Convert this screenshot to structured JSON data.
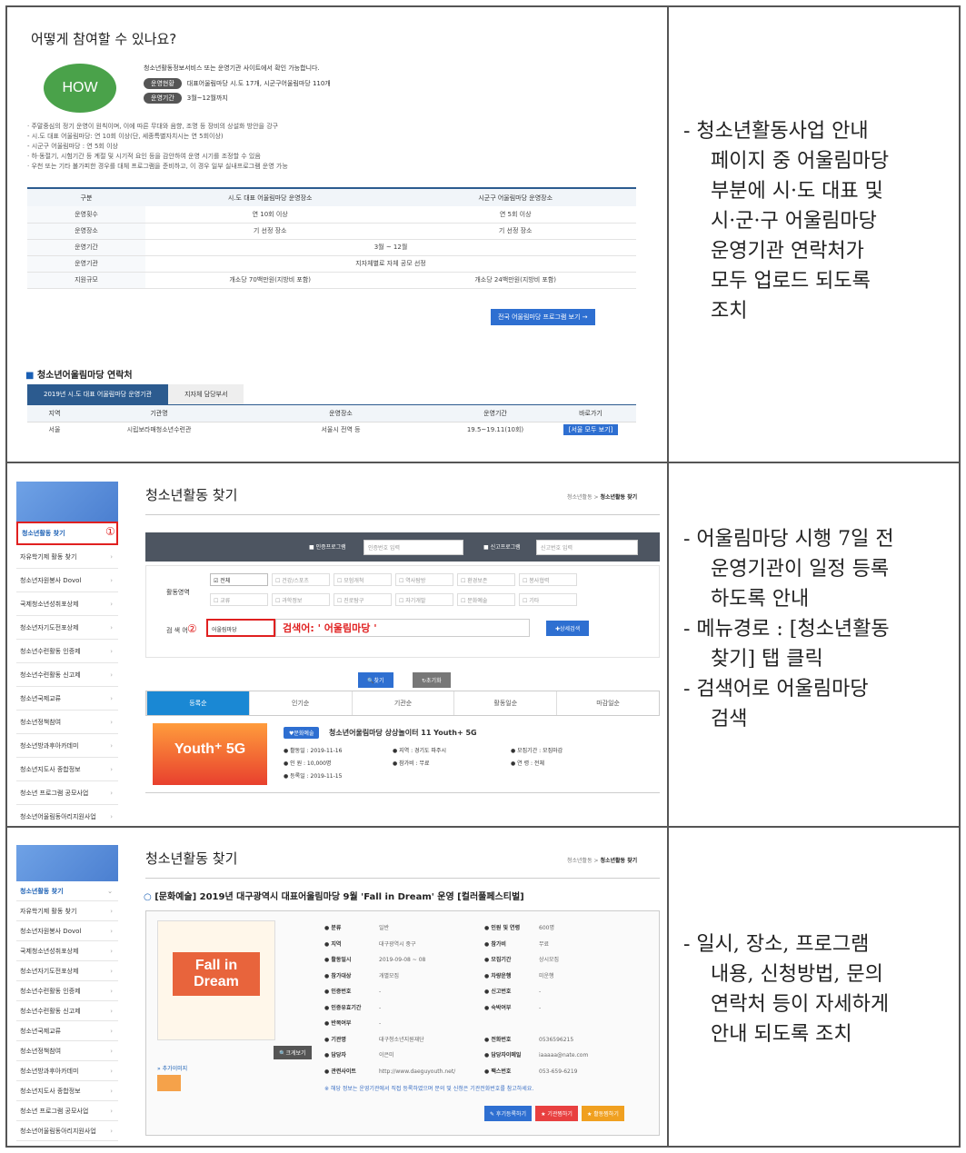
{
  "descriptions": {
    "row1": [
      "- 청소년활동사업 안내",
      "페이지 중 어울림마당",
      "부분에 시·도 대표 및",
      "시·군·구 어울림마당",
      "운영기관 연락처가",
      "모두 업로드 되도록",
      "조치"
    ],
    "row2": [
      "- 어울림마당 시행 7일 전",
      "운영기관이 일정 등록",
      "하도록 안내",
      "- 메뉴경로 : [청소년활동",
      "찾기] 탭 클릭",
      "- 검색어로 어울림마당",
      "검색"
    ],
    "row3": [
      "- 일시, 장소, 프로그램",
      "내용, 신청방법, 문의",
      "연락처 등이 자세하게",
      "안내 되도록 조치"
    ]
  },
  "row1": {
    "title": "어떻게 참여할 수 있나요?",
    "how": "HOW",
    "intro": "청소년활동정보서비스 또는 운영기관 사이트에서 확인 가능합니다.",
    "pill1": "운영현황",
    "pill1_text": "대표어울림마당 시.도 17개, 시군구어울림마당 110개",
    "pill2": "운영기간",
    "pill2_text": "3월~12월까지",
    "notes": [
      "· 주말중심의 정기 운영이 원칙이며, 이에 따른 무대와 음향, 조명 등 장비의 상설화 방안을 강구",
      "   - 시.도 대표 어울림마당: 연 10회 이상(단, 세종특별자치시는 연 5회이상)",
      "   - 시군구 어울림마당 : 연 5회 이상",
      "· 하·동절기, 시험기간 등 계절 및 시기적 요인 등을 감안하여 운영 시기를 조정할 수 있음",
      "· 우천 또는 기타 불가피한 경우를 대체 프로그램을 준비하고, 이 경우 일부 실내프로그램 운영 가능"
    ],
    "table_headers": [
      "구분",
      "시.도 대표 어울림마당 운영장소",
      "시군구 어울림마당 운영장소"
    ],
    "table_rows": [
      [
        "운영횟수",
        "연 10회 이상",
        "연 5회 이상"
      ],
      [
        "운영장소",
        "기 선정 장소",
        "기 선정 장소"
      ],
      [
        "운영기간",
        "3월 ~ 12월",
        ""
      ],
      [
        "운영기관",
        "지자체별로 자체 공모 선정",
        ""
      ],
      [
        "지원규모",
        "개소당 70백만원(지방비 포함)",
        "개소당 24백만원(지방비 포함)"
      ]
    ],
    "program_button": "전국 어울림마당 프로그램 보기 →",
    "contact_title": "청소년어울림마당 연락처",
    "tab1": "2019년 시.도 대표 어울림마당 운영기관",
    "tab2": "지자체 담당부서",
    "contact_headers": [
      "지역",
      "기관명",
      "운영장소",
      "운영기간",
      "바로가기"
    ],
    "contact_row": [
      "서울",
      "시립보라매청소년수련관",
      "서울시 전역 등",
      "19.5~19.11(10회)",
      "[서울 모두 보기]"
    ]
  },
  "sidebar": {
    "items": [
      "청소년활동 찾기",
      "자유학기제 활동 찾기",
      "청소년자원봉사 Dovol",
      "국제청소년성취포상제",
      "청소년자기도전포상제",
      "청소년수련활동 인증제",
      "청소년수련활동 신고제",
      "청소년국제교류",
      "청소년정책참여",
      "청소년방과후아카데미",
      "청소년지도사 종합정보",
      "청소년 프로그램 공모사업",
      "청소년어울림동아리지원사업"
    ]
  },
  "row2": {
    "page_title": "청소년활동 찾기",
    "crumb_home": "청소년활동 >",
    "crumb_current": "청소년활동 찾기",
    "marker1": "①",
    "marker2": "②",
    "cert_label": "■ 인증프로그램",
    "cert_placeholder": "인증번호 입력",
    "report_label": "■ 신고프로그램",
    "report_placeholder": "신고번호 입력",
    "area_label": "활동영역",
    "checks_row1": [
      "☑ 전체",
      "☐ 건강/스포츠",
      "☐ 모험개척",
      "☐ 역사탐방",
      "☐ 환경보존",
      "☐ 봉사협력"
    ],
    "checks_row2": [
      "☐ 교류",
      "☐ 과학정보",
      "☐ 진로탐구",
      "☐ 자기개발",
      "☐ 문화예술",
      "☐ 기타"
    ],
    "search_label": "검 색 어",
    "search_value": "어울림마당",
    "search_hint": "검색어: ' 어울림마당 '",
    "detail_button": "✚상세검색",
    "find_button": "🔍찾기",
    "reset_button": "↻초기화",
    "tabs": [
      "등록순",
      "인기순",
      "기관순",
      "활동일순",
      "마감일순"
    ],
    "poster_title": "Youth⁺ 5G",
    "badge": "♥문화예술",
    "result_title": "청소년어울림마당 상상놀이터 11 Youth+ 5G",
    "info": [
      [
        "● 활동일 : 2019-11-16",
        "● 지역 : 경기도 파주시",
        "● 모집기간 : 모집마감"
      ],
      [
        "● 인 원 : 10,000명",
        "● 참가비 : 무료",
        "● 연 령 : 전체"
      ],
      [
        "● 등록일 : 2019-11-15",
        "",
        ""
      ]
    ]
  },
  "row3": {
    "page_title": "청소년활동 찾기",
    "crumb_home": "청소년활동 >",
    "crumb_current": "청소년활동 찾기",
    "heading": "[문화예술] 2019년 대구광역시 대표어울림마당 9월 'Fall in Dream' 운영 [컬러풀페스티벌]",
    "poster_text": "Fall in Dream",
    "zoom_button": "🔍크게보기",
    "more_images": "» 추가이미지",
    "details_left": [
      [
        "● 분류",
        "일반"
      ],
      [
        "● 지역",
        "대구광역시 중구"
      ],
      [
        "● 활동일시",
        "2019-09-08 ~ 08"
      ],
      [
        "● 참가대상",
        "개별모집"
      ],
      [
        "● 인증번호",
        "-"
      ],
      [
        "● 인증유효기간",
        "-"
      ],
      [
        "● 반복여부",
        "-"
      ],
      [
        "● 기관명",
        "대구청소년지원재단"
      ],
      [
        "● 담당자",
        "이은미"
      ],
      [
        "● 관련사이트",
        "http://www.daeguyouth.net/"
      ]
    ],
    "details_right": [
      [
        "● 인원 및 연령",
        "600명"
      ],
      [
        "● 참가비",
        "무료"
      ],
      [
        "● 모집기간",
        "상시모집"
      ],
      [
        "● 차량운행",
        "미운행"
      ],
      [
        "● 신고번호",
        "-"
      ],
      [
        "● 숙박여부",
        "-"
      ],
      [
        "",
        ""
      ],
      [
        "● 전화번호",
        "0536596215"
      ],
      [
        "● 담당자이메일",
        "iaaaaa@nate.com"
      ],
      [
        "● 팩스번호",
        "053-659-6219"
      ]
    ],
    "note": "※ 해당 정보는 운영기관에서 직접 등록하였으며 문의 및 신청은 기관전화번호를 참고하세요.",
    "btn_review": "✎ 후기등록하기",
    "btn_org": "★ 기관찜하기",
    "btn_activity": "★ 활동찜하기"
  }
}
